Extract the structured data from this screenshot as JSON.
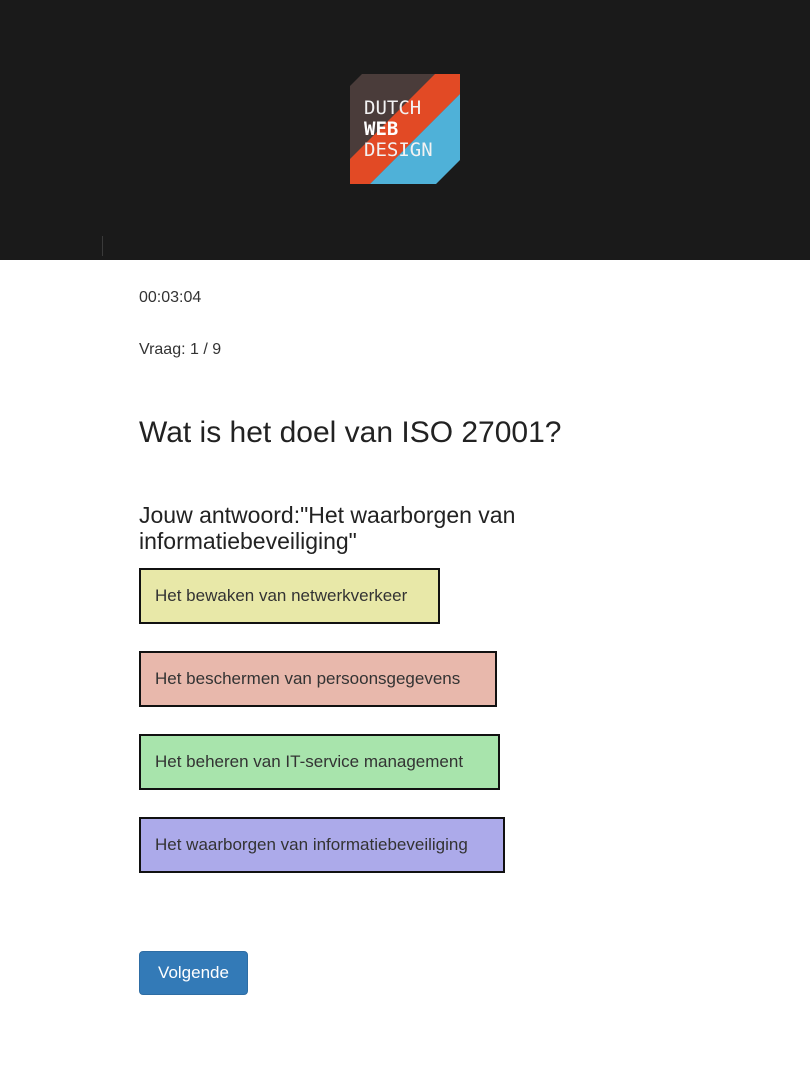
{
  "header": {
    "logo": {
      "line1": "DUTCH",
      "line2": "WEB",
      "line3": "DESIGN",
      "colors": {
        "dark": "#4a3c3a",
        "red": "#e24a25",
        "blue": "#4fb1d8"
      }
    },
    "background": "#1a1a1a"
  },
  "quiz": {
    "timer": "00:03:04",
    "progress": "Vraag: 1 / 9",
    "question": "Wat is het doel van ISO 27001?",
    "your_answer": "Jouw antwoord:\"Het waarborgen van informatiebeveiliging\"",
    "options": [
      {
        "label": "Het bewaken van netwerkverkeer",
        "color": "#e8e8a8"
      },
      {
        "label": "Het beschermen van persoonsgegevens",
        "color": "#e8b8ac"
      },
      {
        "label": "Het beheren van IT-service management",
        "color": "#a8e4ac"
      },
      {
        "label": "Het waarborgen van informatiebeveiliging",
        "color": "#acaaea"
      }
    ],
    "next_label": "Volgende",
    "accent": "#337ab7"
  }
}
